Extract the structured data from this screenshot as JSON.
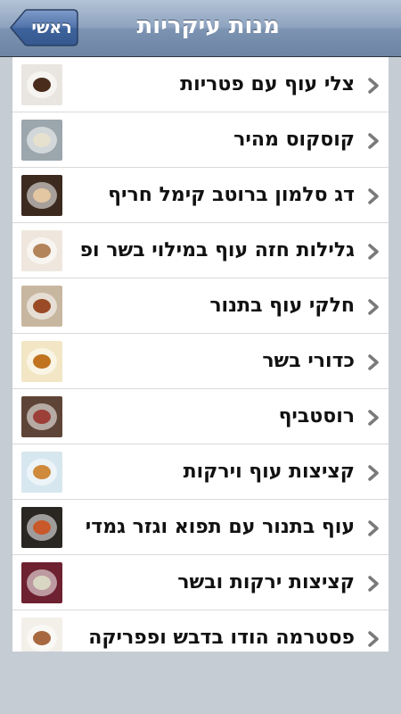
{
  "nav": {
    "title": "מנות עיקריות",
    "back_label": "ראשי",
    "icon": "back-arrow-icon"
  },
  "rows": [
    {
      "label": "צלי עוף עם פטריות",
      "thumb": {
        "bg": "#e9e6e1",
        "food": "#4a2c1c"
      }
    },
    {
      "label": "קוסקוס מהיר",
      "thumb": {
        "bg": "#9ba6ad",
        "food": "#e6e0cf"
      }
    },
    {
      "label": "דג סלמון ברוטב קימל חריף",
      "thumb": {
        "bg": "#3c2a1f",
        "food": "#e3c7a2"
      }
    },
    {
      "label": "גלילות חזה עוף במילוי בשר ופ",
      "thumb": {
        "bg": "#efe7dd",
        "food": "#b3845a"
      }
    },
    {
      "label": "חלקי עוף בתנור",
      "thumb": {
        "bg": "#c8b7a0",
        "food": "#9a4a25"
      }
    },
    {
      "label": "כדורי בשר",
      "thumb": {
        "bg": "#f2e6c4",
        "food": "#c17320"
      }
    },
    {
      "label": "רוסטביף",
      "thumb": {
        "bg": "#5e4437",
        "food": "#9c3f38"
      }
    },
    {
      "label": "קציצות עוף וירקות",
      "thumb": {
        "bg": "#d7e7ef",
        "food": "#cf8a3b"
      }
    },
    {
      "label": "עוף בתנור עם תפוא וגזר גמדי",
      "thumb": {
        "bg": "#2a2622",
        "food": "#c9582a"
      }
    },
    {
      "label": "קציצות ירקות ובשר",
      "thumb": {
        "bg": "#6e2130",
        "food": "#d9d7c4"
      }
    },
    {
      "label": "פסטרמה הודו בדבש ופפריקה",
      "thumb": {
        "bg": "#f3efe9",
        "food": "#a8683f"
      }
    }
  ],
  "row_icon": "chevron-right-icon"
}
